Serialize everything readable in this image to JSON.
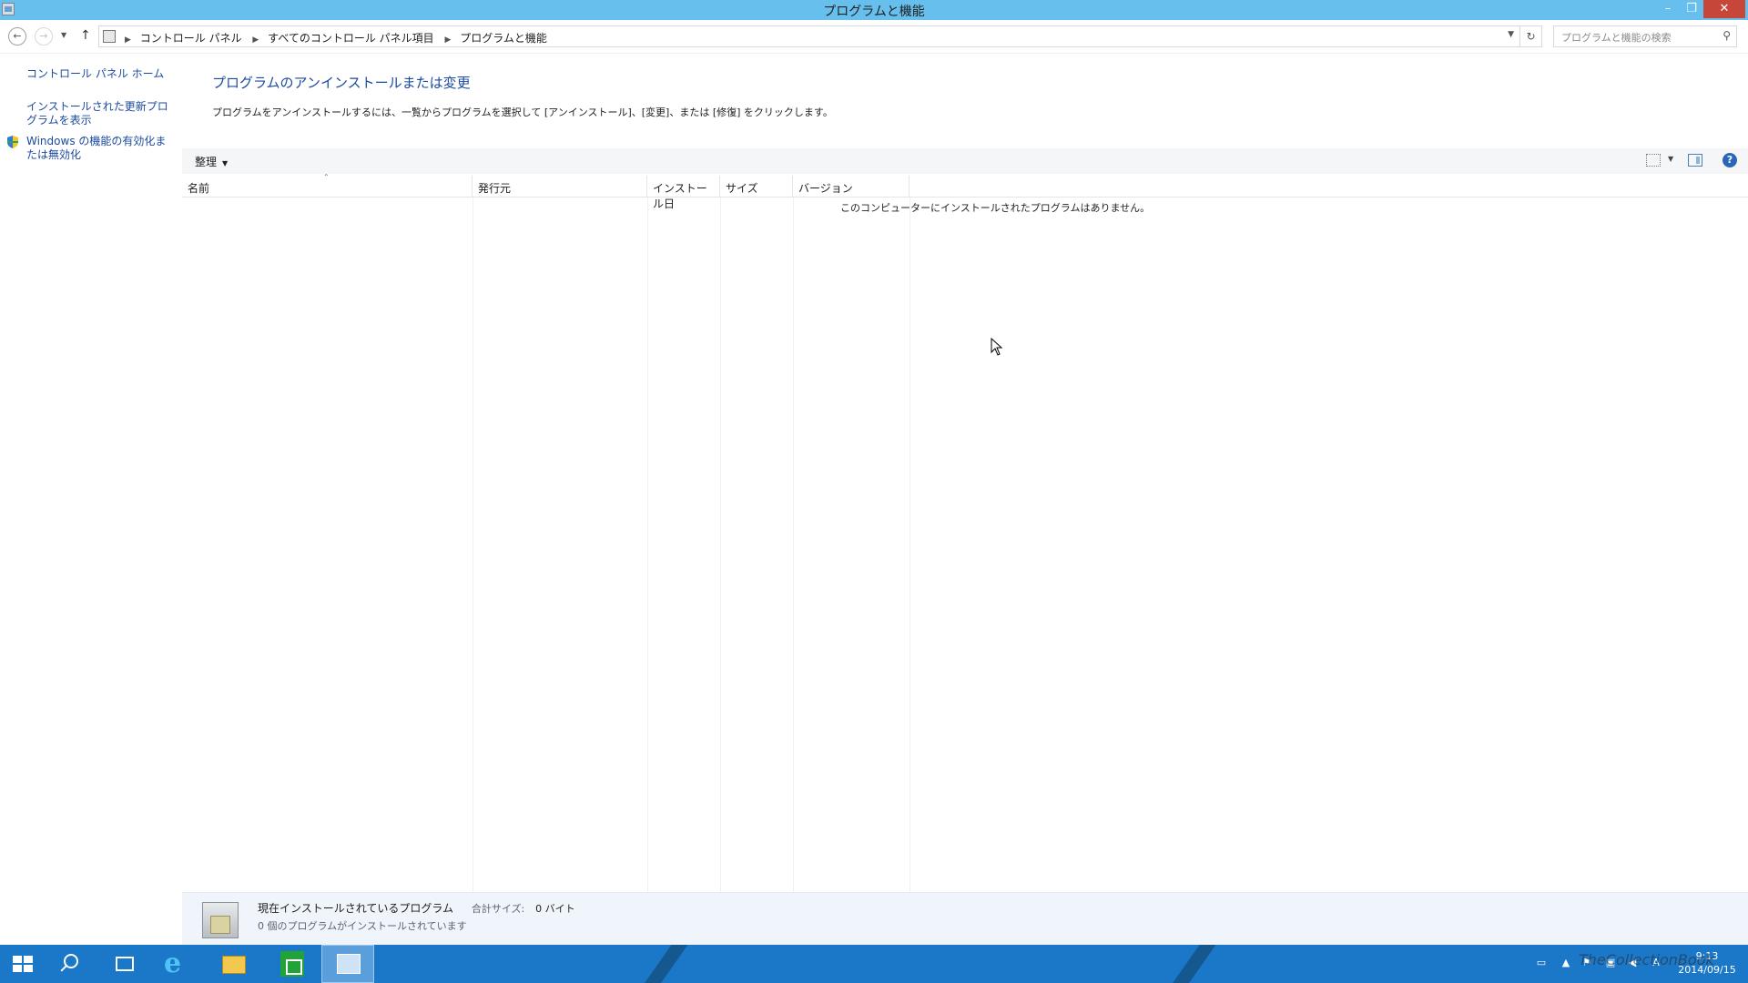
{
  "window": {
    "title": "プログラムと機能",
    "min_label": "–",
    "max_label": "❐",
    "close_label": "✕"
  },
  "nav": {
    "back_icon": "arrow-left-icon",
    "forward_icon": "arrow-right-icon",
    "up_icon": "arrow-up-icon",
    "breadcrumbs": [
      "コントロール パネル",
      "すべてのコントロール パネル項目",
      "プログラムと機能"
    ],
    "search_placeholder": "プログラムと機能の検索"
  },
  "left_pane": {
    "links": [
      "コントロール パネル ホーム",
      "インストールされた更新プログラムを表示",
      "Windows の機能の有効化または無効化"
    ]
  },
  "main": {
    "heading": "プログラムのアンインストールまたは変更",
    "description": "プログラムをアンインストールするには、一覧からプログラムを選択して [アンインストール]、[変更]、または [修復] をクリックします。"
  },
  "toolbar": {
    "organize_label": "整理"
  },
  "columns": [
    "名前",
    "発行元",
    "インストール日",
    "サイズ",
    "バージョン"
  ],
  "list": {
    "empty_message": "このコンピューターにインストールされたプログラムはありません。",
    "rows": []
  },
  "details": {
    "title": "現在インストールされているプログラム",
    "total_size_label": "合計サイズ:",
    "total_size_value": "0 バイト",
    "count_text": "0 個のプログラムがインストールされています"
  },
  "taskbar": {
    "clock_time": "9:13",
    "clock_date": "2014/09/15",
    "ime_label": "A",
    "watermark": "TheCollectionBook"
  }
}
